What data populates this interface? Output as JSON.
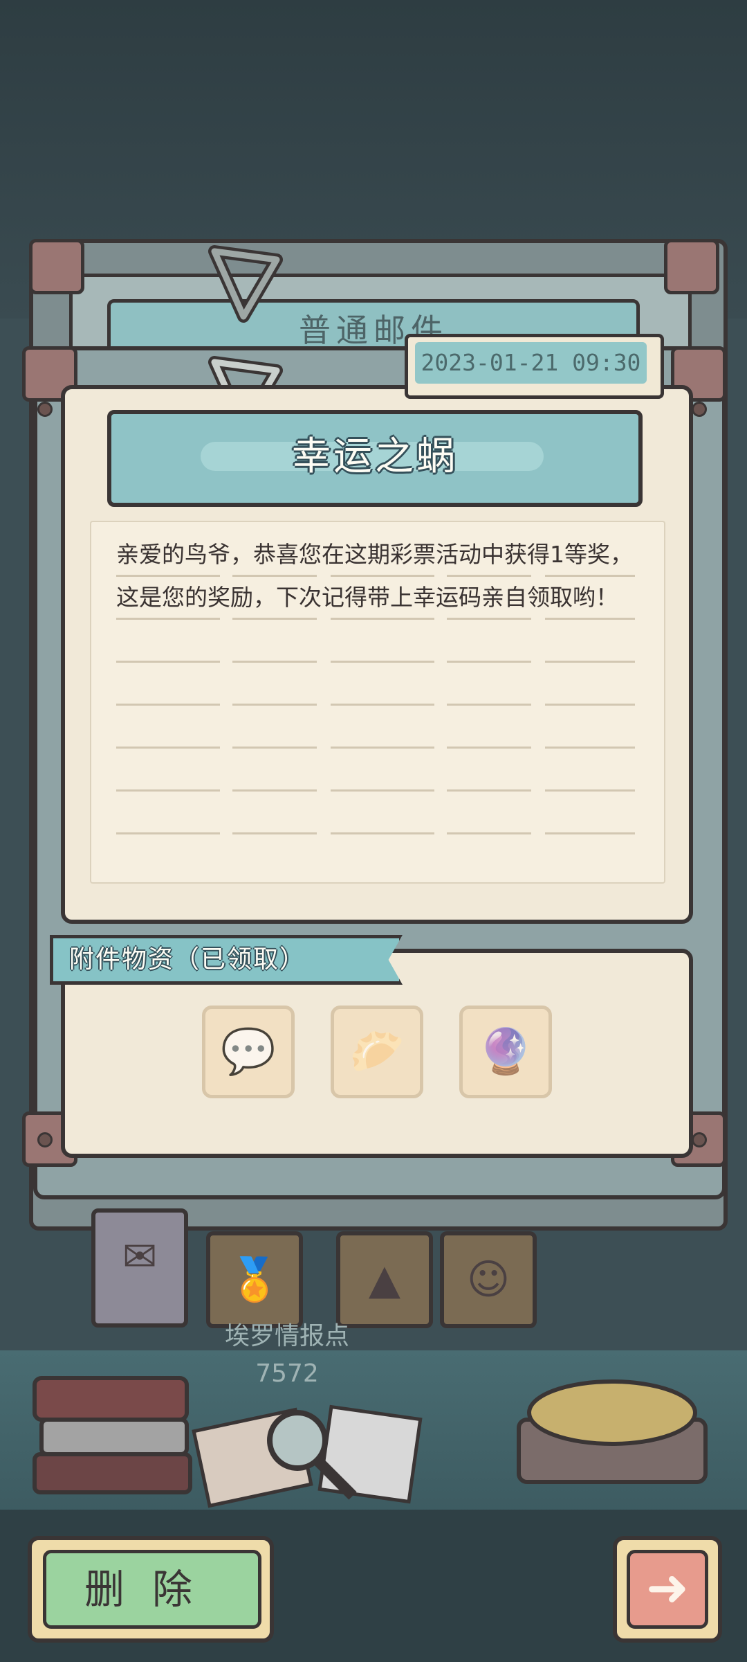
{
  "mail": {
    "back_title": "普通邮件",
    "date": "2023-01-21 09:30",
    "title": "幸运之蜗",
    "message": "亲爱的鸟爷，恭喜您在这期彩票活动中获得1等奖，这是您的奖励，下次记得带上幸运码亲自领取哟！"
  },
  "attachments": {
    "label": "附件物资（已领取）",
    "items": [
      {
        "icon": "ghost-icon",
        "glyph": "💬"
      },
      {
        "icon": "dumpling-icon",
        "glyph": "🥟"
      },
      {
        "icon": "crystal-ball-icon",
        "glyph": "🔮"
      }
    ]
  },
  "tabs": [
    {
      "name": "mail",
      "glyph": "✉"
    },
    {
      "name": "award",
      "glyph": "🏅"
    },
    {
      "name": "shop",
      "glyph": "▲"
    },
    {
      "name": "character",
      "glyph": "☺"
    }
  ],
  "intel": {
    "label": "埃罗情报点",
    "value": "7572"
  },
  "buttons": {
    "delete": "删除",
    "next": "➜"
  },
  "colors": {
    "accent": "#8fc3c6",
    "paper": "#f1e9d8",
    "delete_green": "#9bd39f",
    "next_red": "#e79b8d"
  }
}
